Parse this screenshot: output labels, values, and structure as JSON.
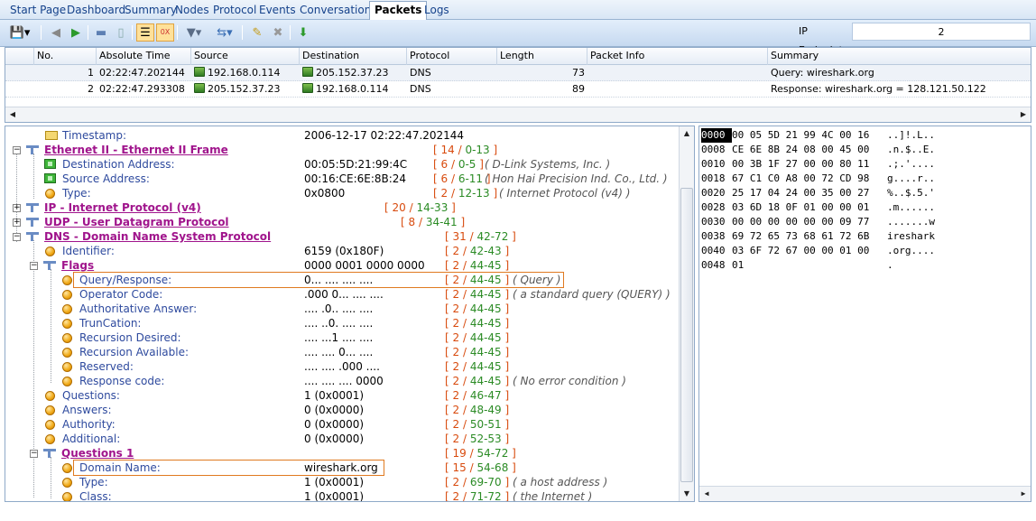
{
  "tabs": [
    "Start Page",
    "Dashboard",
    "Summary",
    "Nodes",
    "Protocol",
    "Events",
    "Conversations",
    "Packets",
    "Logs"
  ],
  "active_tab": "Packets",
  "toolbar": {
    "ip_endpoint_label": "IP Endpoint",
    "ip_endpoint_value": "2"
  },
  "packet_list": {
    "columns": [
      "No.",
      "Absolute Time",
      "Source",
      "Destination",
      "Protocol",
      "Length",
      "Packet Info",
      "Summary"
    ],
    "rows": [
      {
        "no": "1",
        "time": "02:22:47.202144",
        "source": "192.168.0.114",
        "destination": "205.152.37.23",
        "protocol": "DNS",
        "length": "73",
        "info": "",
        "summary": "Query: wireshark.org"
      },
      {
        "no": "2",
        "time": "02:22:47.293308",
        "source": "205.152.37.23",
        "destination": "192.168.0.114",
        "protocol": "DNS",
        "length": "89",
        "info": "",
        "summary": "Response: wireshark.org = 128.121.50.122"
      }
    ]
  },
  "tree": [
    {
      "label": "Timestamp:",
      "value": "2006-12-17 02:22:47.202144",
      "r1": "",
      "r2": "",
      "desc": ""
    },
    {
      "label": "Ethernet II - Ethernet II Frame",
      "value": "",
      "r1": "14",
      "r2": "0-13",
      "desc": ""
    },
    {
      "label": "Destination Address:",
      "value": "00:05:5D:21:99:4C",
      "r1": "6",
      "r2": "0-5",
      "desc": "( D-Link Systems, Inc. )"
    },
    {
      "label": "Source Address:",
      "value": "00:16:CE:6E:8B:24",
      "r1": "6",
      "r2": "6-11",
      "desc": "( Hon Hai Precision Ind. Co., Ltd. )"
    },
    {
      "label": "Type:",
      "value": "0x0800",
      "r1": "2",
      "r2": "12-13",
      "desc": "( Internet Protocol (v4) )"
    },
    {
      "label": "IP - Internet Protocol (v4)",
      "value": "",
      "r1": "20",
      "r2": "14-33",
      "desc": ""
    },
    {
      "label": "UDP - User Datagram Protocol",
      "value": "",
      "r1": "8",
      "r2": "34-41",
      "desc": ""
    },
    {
      "label": "DNS - Domain Name System Protocol",
      "value": "",
      "r1": "31",
      "r2": "42-72",
      "desc": ""
    },
    {
      "label": "Identifier:",
      "value": "6159 (0x180F)",
      "r1": "2",
      "r2": "42-43",
      "desc": ""
    },
    {
      "label": "Flags",
      "value": "0000 0001 0000 0000",
      "r1": "2",
      "r2": "44-45",
      "desc": ""
    },
    {
      "label": "Query/Response:",
      "value": "0... .... .... ....",
      "r1": "2",
      "r2": "44-45",
      "desc": "( Query )"
    },
    {
      "label": "Operator Code:",
      "value": ".000 0... .... ....",
      "r1": "2",
      "r2": "44-45",
      "desc": "( a standard query (QUERY) )"
    },
    {
      "label": "Authoritative Answer:",
      "value": ".... .0.. .... ....",
      "r1": "2",
      "r2": "44-45",
      "desc": ""
    },
    {
      "label": "TrunCation:",
      "value": ".... ..0. .... ....",
      "r1": "2",
      "r2": "44-45",
      "desc": ""
    },
    {
      "label": "Recursion Desired:",
      "value": ".... ...1 .... ....",
      "r1": "2",
      "r2": "44-45",
      "desc": ""
    },
    {
      "label": "Recursion Available:",
      "value": ".... .... 0... ....",
      "r1": "2",
      "r2": "44-45",
      "desc": ""
    },
    {
      "label": "Reserved:",
      "value": ".... .... .000 ....",
      "r1": "2",
      "r2": "44-45",
      "desc": ""
    },
    {
      "label": "Response code:",
      "value": ".... .... .... 0000",
      "r1": "2",
      "r2": "44-45",
      "desc": "( No error condition )"
    },
    {
      "label": "Questions:",
      "value": "1 (0x0001)",
      "r1": "2",
      "r2": "46-47",
      "desc": ""
    },
    {
      "label": "Answers:",
      "value": "0 (0x0000)",
      "r1": "2",
      "r2": "48-49",
      "desc": ""
    },
    {
      "label": "Authority:",
      "value": "0 (0x0000)",
      "r1": "2",
      "r2": "50-51",
      "desc": ""
    },
    {
      "label": "Additional:",
      "value": "0 (0x0000)",
      "r1": "2",
      "r2": "52-53",
      "desc": ""
    },
    {
      "label": "Questions 1",
      "value": "",
      "r1": "19",
      "r2": "54-72",
      "desc": ""
    },
    {
      "label": "Domain Name:",
      "value": "wireshark.org",
      "r1": "15",
      "r2": "54-68",
      "desc": ""
    },
    {
      "label": "Type:",
      "value": "1 (0x0001)",
      "r1": "2",
      "r2": "69-70",
      "desc": "( a host address )"
    },
    {
      "label": "Class:",
      "value": "1 (0x0001)",
      "r1": "2",
      "r2": "71-72",
      "desc": "( the Internet )"
    }
  ],
  "hex": [
    {
      "off": "0000",
      "bytes": "00 05 5D 21 99 4C 00 16",
      "ascii": "..]!.L.."
    },
    {
      "off": "0008",
      "bytes": "CE 6E 8B 24 08 00 45 00",
      "ascii": ".n.$..E."
    },
    {
      "off": "0010",
      "bytes": "00 3B 1F 27 00 00 80 11",
      "ascii": ".;.'...."
    },
    {
      "off": "0018",
      "bytes": "67 C1 C0 A8 00 72 CD 98",
      "ascii": "g....r.."
    },
    {
      "off": "0020",
      "bytes": "25 17 04 24 00 35 00 27",
      "ascii": "%..$.5.'"
    },
    {
      "off": "0028",
      "bytes": "03 6D 18 0F 01 00 00 01",
      "ascii": ".m......"
    },
    {
      "off": "0030",
      "bytes": "00 00 00 00 00 00 09 77",
      "ascii": ".......w"
    },
    {
      "off": "0038",
      "bytes": "69 72 65 73 68 61 72 6B",
      "ascii": "ireshark"
    },
    {
      "off": "0040",
      "bytes": "03 6F 72 67 00 00 01 00",
      "ascii": ".org...."
    },
    {
      "off": "0048",
      "bytes": "01",
      "ascii": "."
    }
  ]
}
